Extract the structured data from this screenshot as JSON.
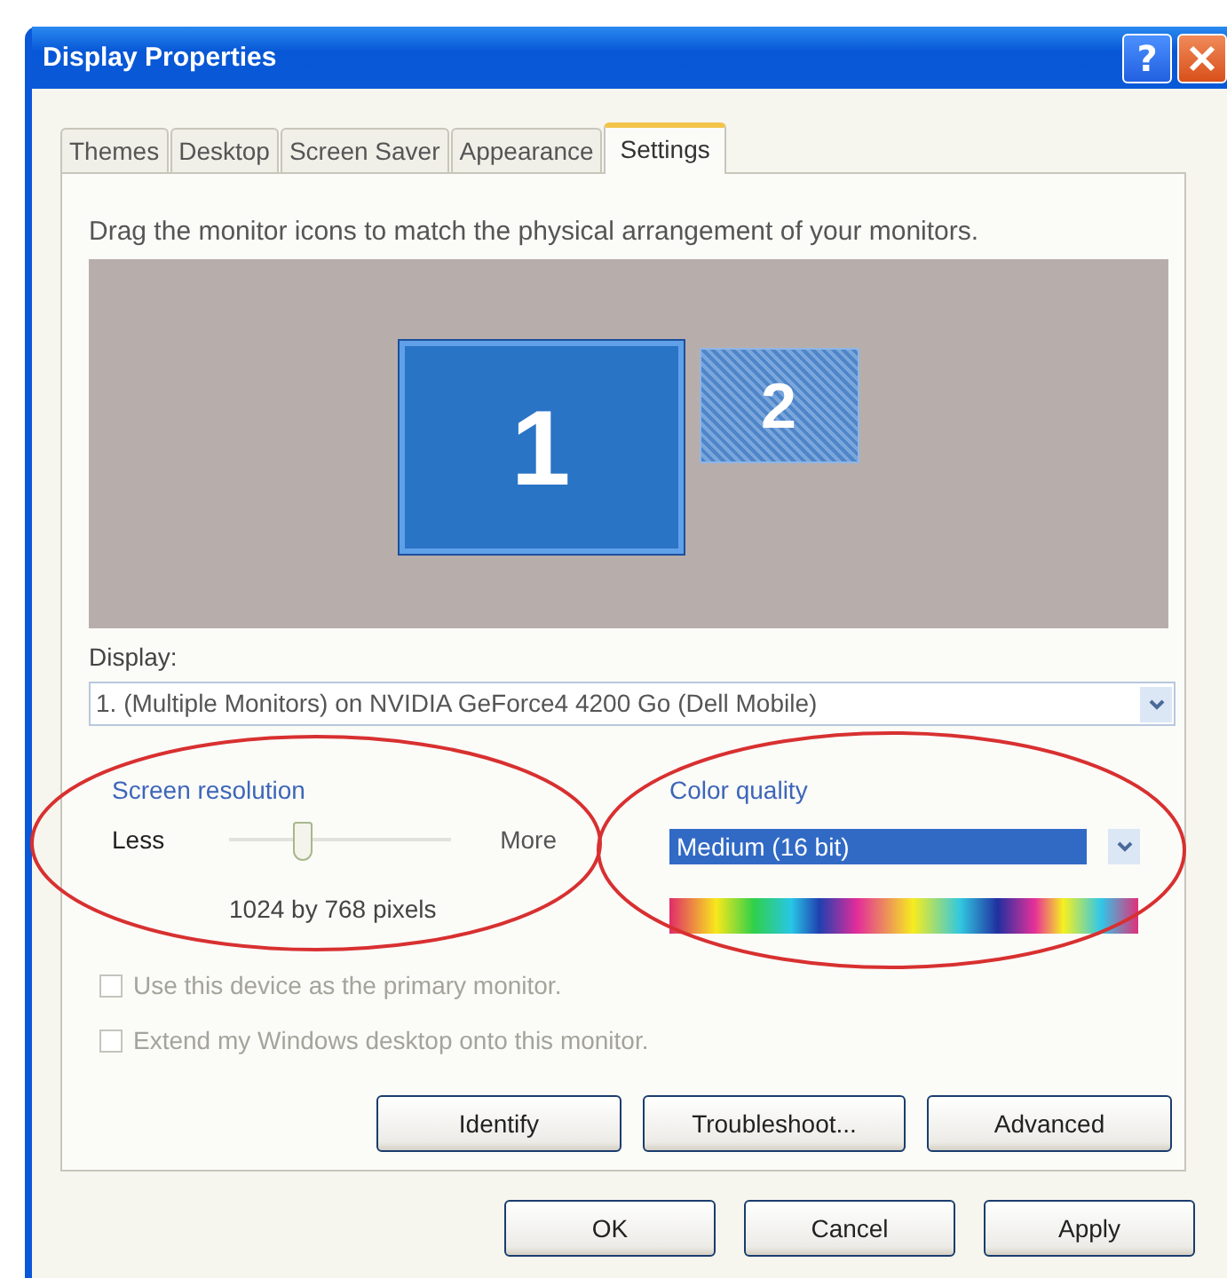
{
  "window": {
    "title": "Display Properties",
    "help": "?"
  },
  "tabs": [
    {
      "label": "Themes",
      "selected": false
    },
    {
      "label": "Desktop",
      "selected": false
    },
    {
      "label": "Screen Saver",
      "selected": false
    },
    {
      "label": "Appearance",
      "selected": false
    },
    {
      "label": "Settings",
      "selected": true
    }
  ],
  "instructions": "Drag the monitor icons to match the physical arrangement of your monitors.",
  "monitors": [
    {
      "number": "1",
      "selected": true
    },
    {
      "number": "2",
      "selected": false
    }
  ],
  "display": {
    "label": "Display:",
    "value": "1. (Multiple Monitors) on NVIDIA GeForce4 4200 Go (Dell Mobile)"
  },
  "screen_resolution": {
    "label": "Screen resolution",
    "less": "Less",
    "more": "More",
    "level": 0.33,
    "reading": "1024 by 768 pixels"
  },
  "color_quality": {
    "label": "Color quality",
    "value": "Medium (16 bit)"
  },
  "checkboxes": [
    {
      "label": "Use this device as the primary monitor.",
      "checked": false,
      "disabled": true
    },
    {
      "label": "Extend my Windows desktop onto this monitor.",
      "checked": false,
      "disabled": true
    }
  ],
  "panel_buttons": [
    "Identify",
    "Troubleshoot...",
    "Advanced"
  ],
  "dialog_buttons": [
    "OK",
    "Cancel",
    "Apply"
  ]
}
